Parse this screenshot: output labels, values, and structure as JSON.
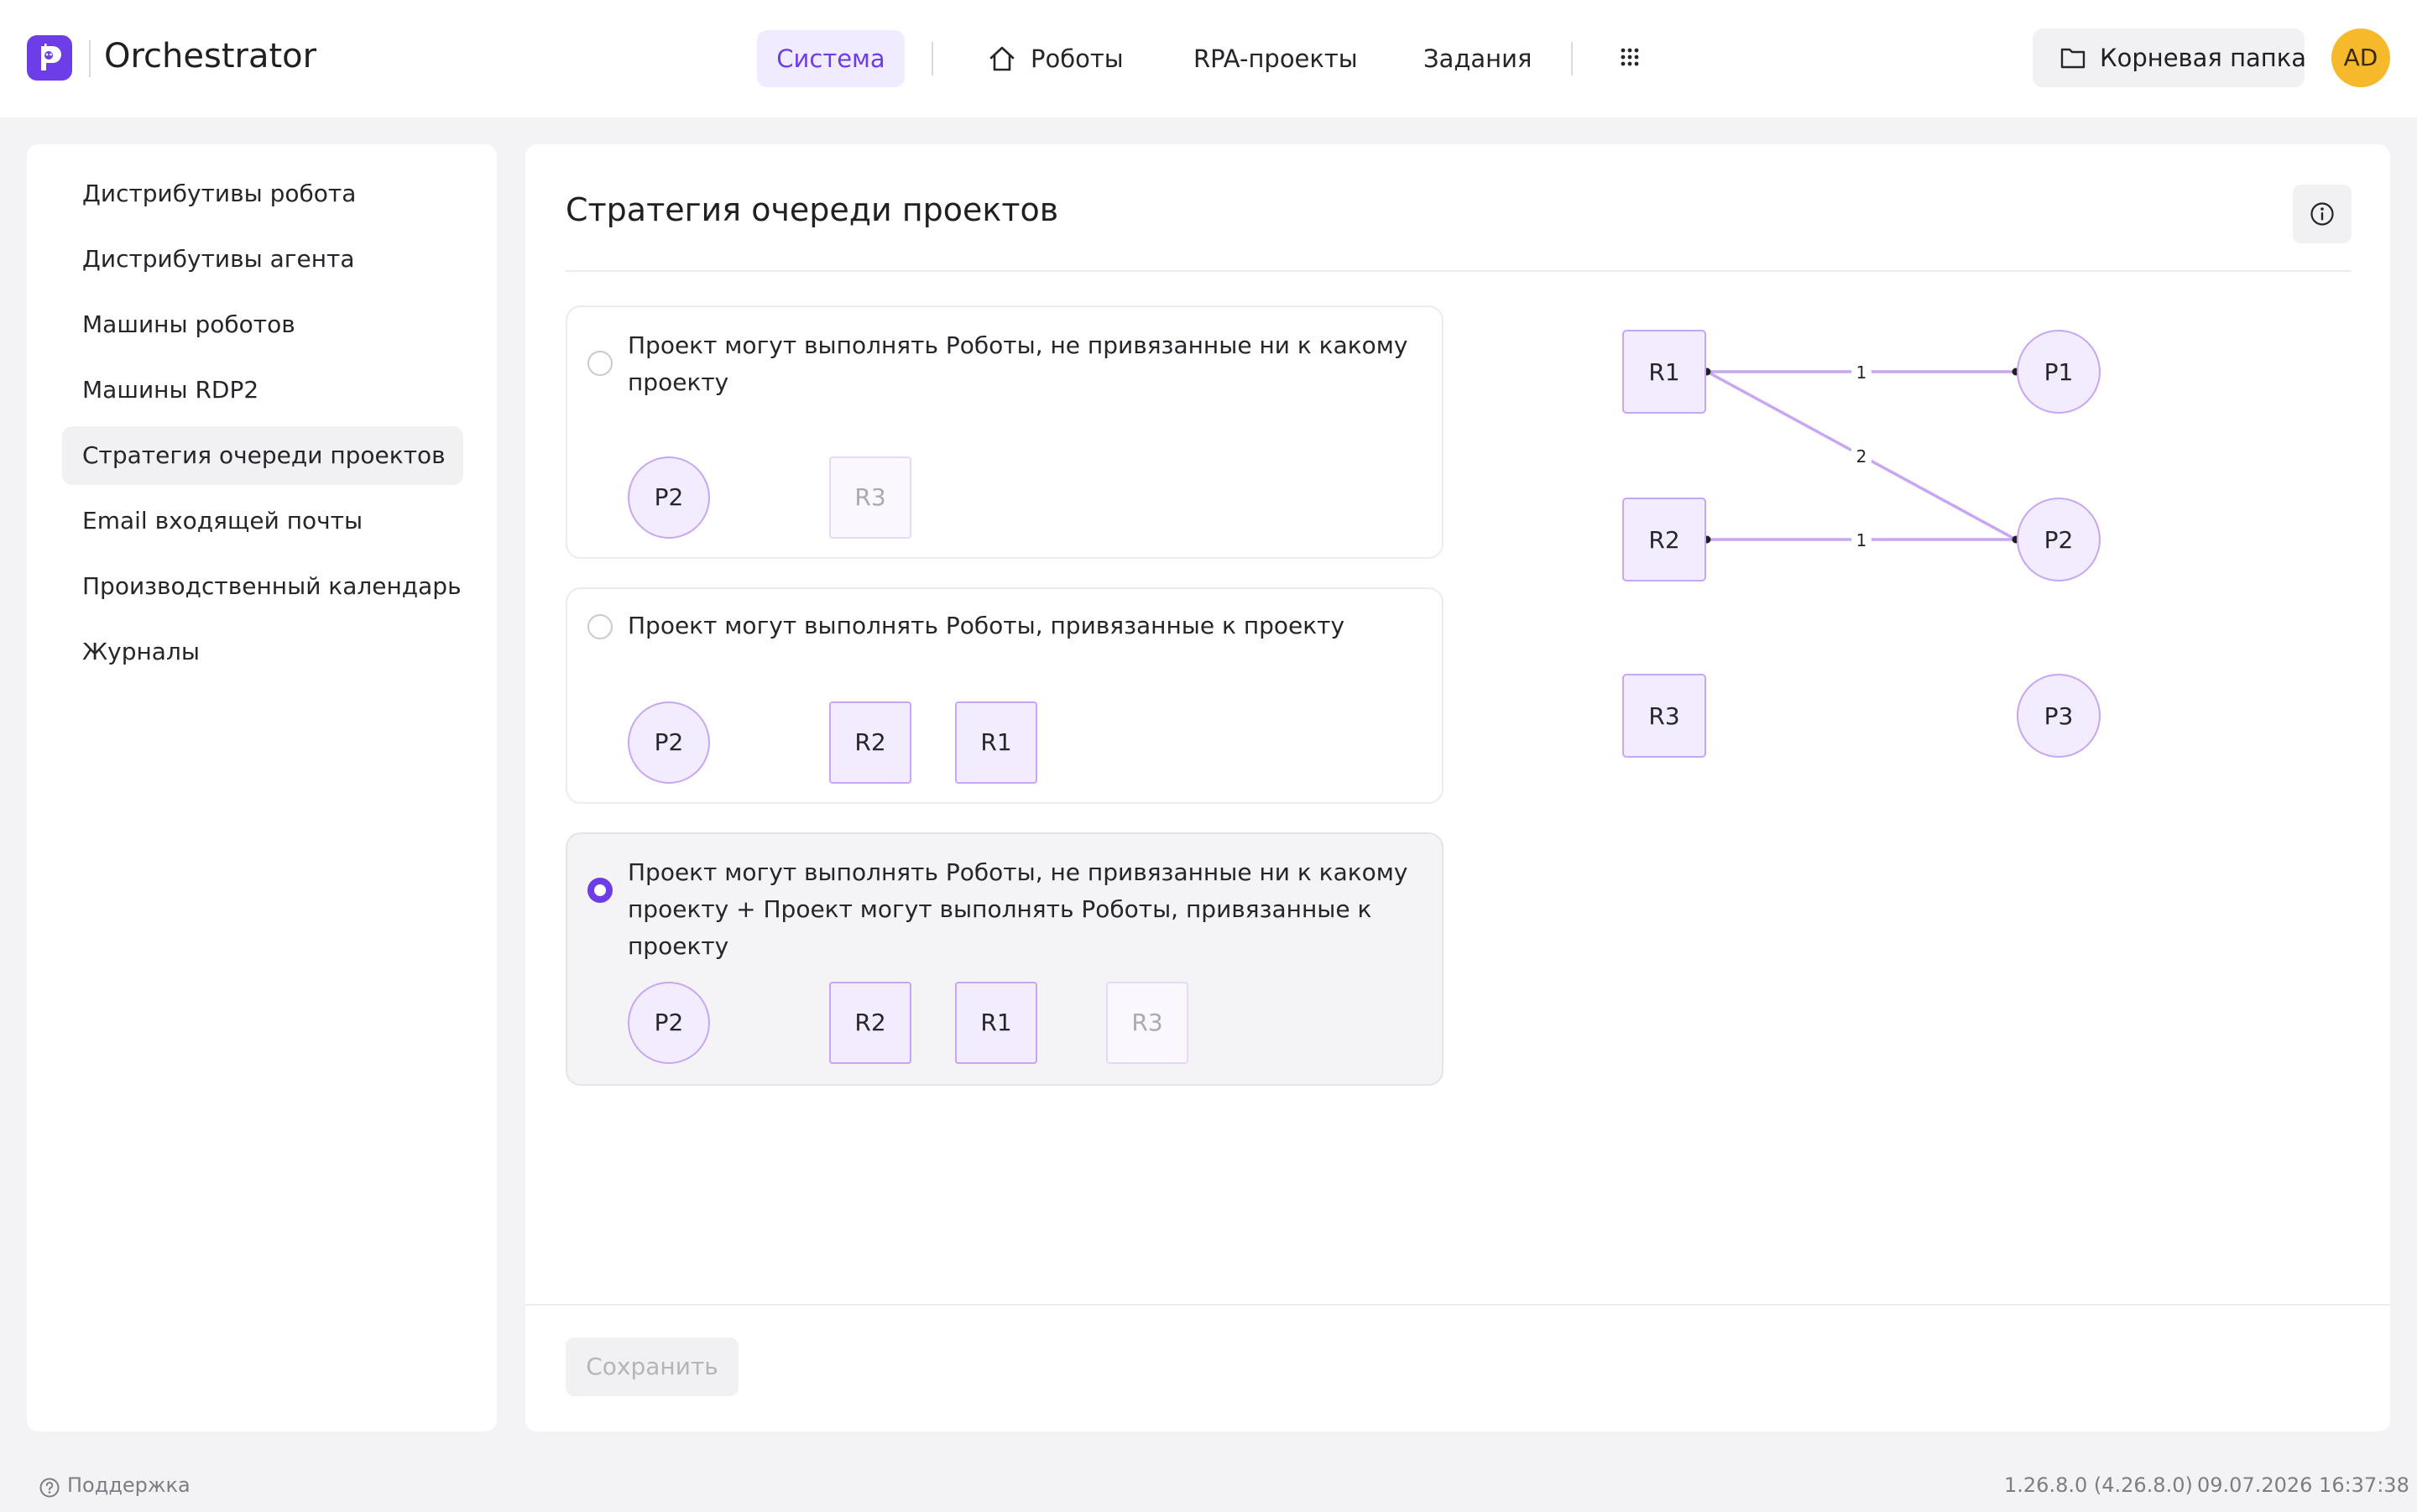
{
  "app": {
    "title": "Orchestrator",
    "logo": "robot-logo-icon"
  },
  "nav": {
    "active": "Система",
    "robots": "Роботы",
    "rpa": "RPA-проекты",
    "tasks": "Задания",
    "apps_icon": "grid-icon",
    "home_icon": "home-icon"
  },
  "root_folder": {
    "label": "Корневая папка",
    "icon": "folder-icon"
  },
  "avatar": "AD",
  "sidebar": {
    "items": [
      {
        "label": "Дистрибутивы робота"
      },
      {
        "label": "Дистрибутивы агента"
      },
      {
        "label": "Машины роботов"
      },
      {
        "label": "Машины RDP2"
      },
      {
        "label": "Стратегия очереди проектов",
        "active": true
      },
      {
        "label": "Email входящей почты"
      },
      {
        "label": "Производственный календарь"
      },
      {
        "label": "Журналы"
      }
    ]
  },
  "page": {
    "title": "Стратегия очереди проектов",
    "info_icon": "info-icon"
  },
  "options": [
    {
      "text": "Проект могут выполнять Роботы, не привязанные ни к какому проекту",
      "selected": false,
      "project": "P2",
      "robots": [
        {
          "label": "R3",
          "faded": true
        }
      ]
    },
    {
      "text": "Проект могут выполнять Роботы, привязанные к проекту",
      "selected": false,
      "project": "P2",
      "robots": [
        {
          "label": "R2",
          "faded": false
        },
        {
          "label": "R1",
          "faded": false
        }
      ]
    },
    {
      "text": "Проект могут выполнять Роботы, не привязанные ни к какому проекту + Проект могут выполнять Роботы, привязанные к проекту",
      "selected": true,
      "project": "P2",
      "robots": [
        {
          "label": "R2",
          "faded": false
        },
        {
          "label": "R1",
          "faded": false
        },
        {
          "label": "R3",
          "faded": true
        }
      ]
    }
  ],
  "diagram": {
    "robots": [
      "R1",
      "R2",
      "R3"
    ],
    "projects": [
      "P1",
      "P2",
      "P3"
    ],
    "edges": [
      {
        "from": "R1",
        "to": "P1",
        "label": "1"
      },
      {
        "from": "R1",
        "to": "P2",
        "label": "2"
      },
      {
        "from": "R2",
        "to": "P2",
        "label": "1"
      }
    ]
  },
  "save_label": "Сохранить",
  "status": {
    "support": "Поддержка",
    "support_icon": "help-circle-icon",
    "version": "1.26.8.0 (4.26.8.0)",
    "datetime": "09.07.2026 16:37:38"
  },
  "colors": {
    "accent": "#6d3ee8",
    "node_border": "#c7a6f3",
    "node_fill": "#f3ecff",
    "avatar": "#f6b92b"
  }
}
